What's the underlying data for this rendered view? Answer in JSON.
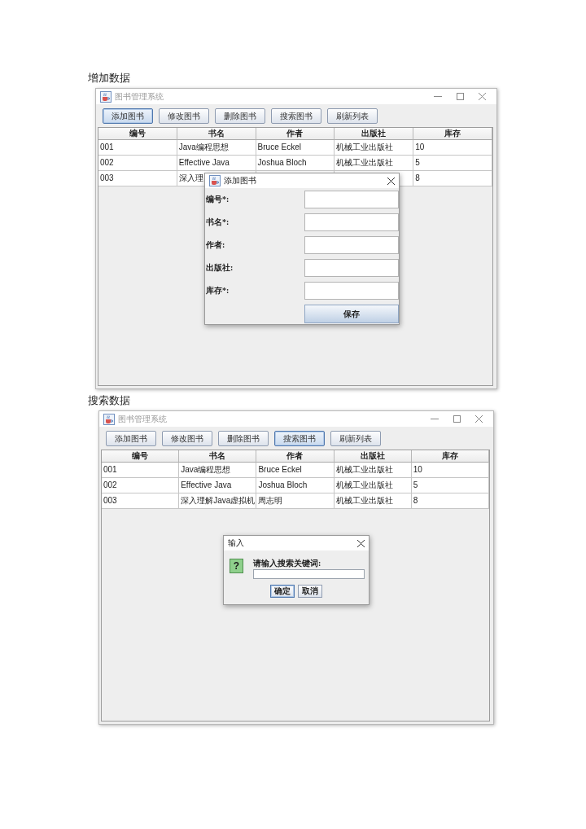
{
  "sections": [
    {
      "heading": "增加数据",
      "window": {
        "title": "图书管理系统",
        "toolbar": [
          {
            "label": "添加图书",
            "focused": true
          },
          {
            "label": "修改图书",
            "focused": false
          },
          {
            "label": "删除图书",
            "focused": false
          },
          {
            "label": "搜索图书",
            "focused": false
          },
          {
            "label": "刷新列表",
            "focused": false
          }
        ],
        "table": {
          "columns": [
            "编号",
            "书名",
            "作者",
            "出版社",
            "库存"
          ],
          "rows": [
            [
              "001",
              "Java编程思想",
              "Bruce Eckel",
              "机械工业出版社",
              "10"
            ],
            [
              "002",
              "Effective Java",
              "Joshua Bloch",
              "机械工业出版社",
              "5"
            ],
            [
              "003",
              "深入理",
              null,
              null,
              "8"
            ]
          ]
        },
        "dialog": {
          "kind": "form",
          "title": "添加图书",
          "fields": [
            {
              "label": "编号*:"
            },
            {
              "label": "书名*:"
            },
            {
              "label": "作者:"
            },
            {
              "label": "出版社:"
            },
            {
              "label": "库存*:"
            }
          ],
          "buttons": [
            {
              "label": "保存",
              "focused": true
            }
          ]
        }
      }
    },
    {
      "heading": "搜索数据",
      "window": {
        "title": "图书管理系统",
        "toolbar": [
          {
            "label": "添加图书",
            "focused": false
          },
          {
            "label": "修改图书",
            "focused": false
          },
          {
            "label": "删除图书",
            "focused": false
          },
          {
            "label": "搜索图书",
            "focused": true
          },
          {
            "label": "刷新列表",
            "focused": false
          }
        ],
        "table": {
          "columns": [
            "编号",
            "书名",
            "作者",
            "出版社",
            "库存"
          ],
          "rows": [
            [
              "001",
              "Java编程思想",
              "Bruce Eckel",
              "机械工业出版社",
              "10"
            ],
            [
              "002",
              "Effective Java",
              "Joshua Bloch",
              "机械工业出版社",
              "5"
            ],
            [
              "003",
              "深入理解Java虚拟机",
              "周志明",
              "机械工业出版社",
              "8"
            ]
          ]
        },
        "dialog": {
          "kind": "input",
          "title": "输入",
          "icon": "?",
          "prompt": "请输入搜索关键词:",
          "buttons": [
            {
              "label": "确定",
              "focused": true
            },
            {
              "label": "取消",
              "focused": false
            }
          ]
        }
      }
    }
  ]
}
